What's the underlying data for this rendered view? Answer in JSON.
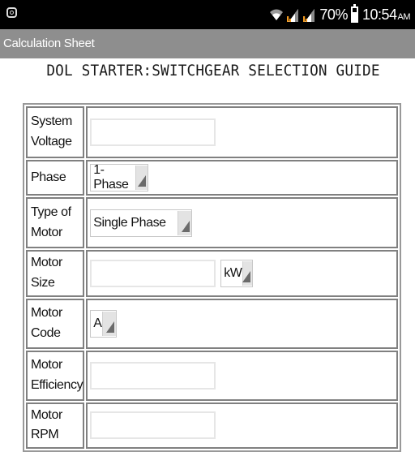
{
  "status_bar": {
    "battery_percent": "70%",
    "battery_level": 0.7,
    "time": "10:54",
    "ampm": "AM"
  },
  "action_bar": {
    "title": "Calculation Sheet"
  },
  "page": {
    "title": "DOL STARTER:SWITCHGEAR SELECTION GUIDE"
  },
  "form": {
    "system_voltage": {
      "label_l1": "System",
      "label_l2": "Voltage",
      "value": ""
    },
    "phase": {
      "label": "Phase",
      "selected": "1-Phase"
    },
    "motor_type": {
      "label_l1": "Type of",
      "label_l2": "Motor",
      "selected": "Single Phase"
    },
    "motor_size": {
      "label": "Motor Size",
      "value": "",
      "unit_selected": "kW"
    },
    "motor_code": {
      "label_l1": "Motor",
      "label_l2": "Code",
      "selected": "A"
    },
    "motor_efficiency": {
      "label_l1": "Motor",
      "label_l2": "Efficiency",
      "value": ""
    },
    "motor_rpm": {
      "label": "Motor RPM",
      "value": ""
    }
  },
  "colors": {
    "status_bar_bg": "#000000",
    "action_bar_bg": "#8e8e8e",
    "signal_accent": "#f39a1e"
  }
}
